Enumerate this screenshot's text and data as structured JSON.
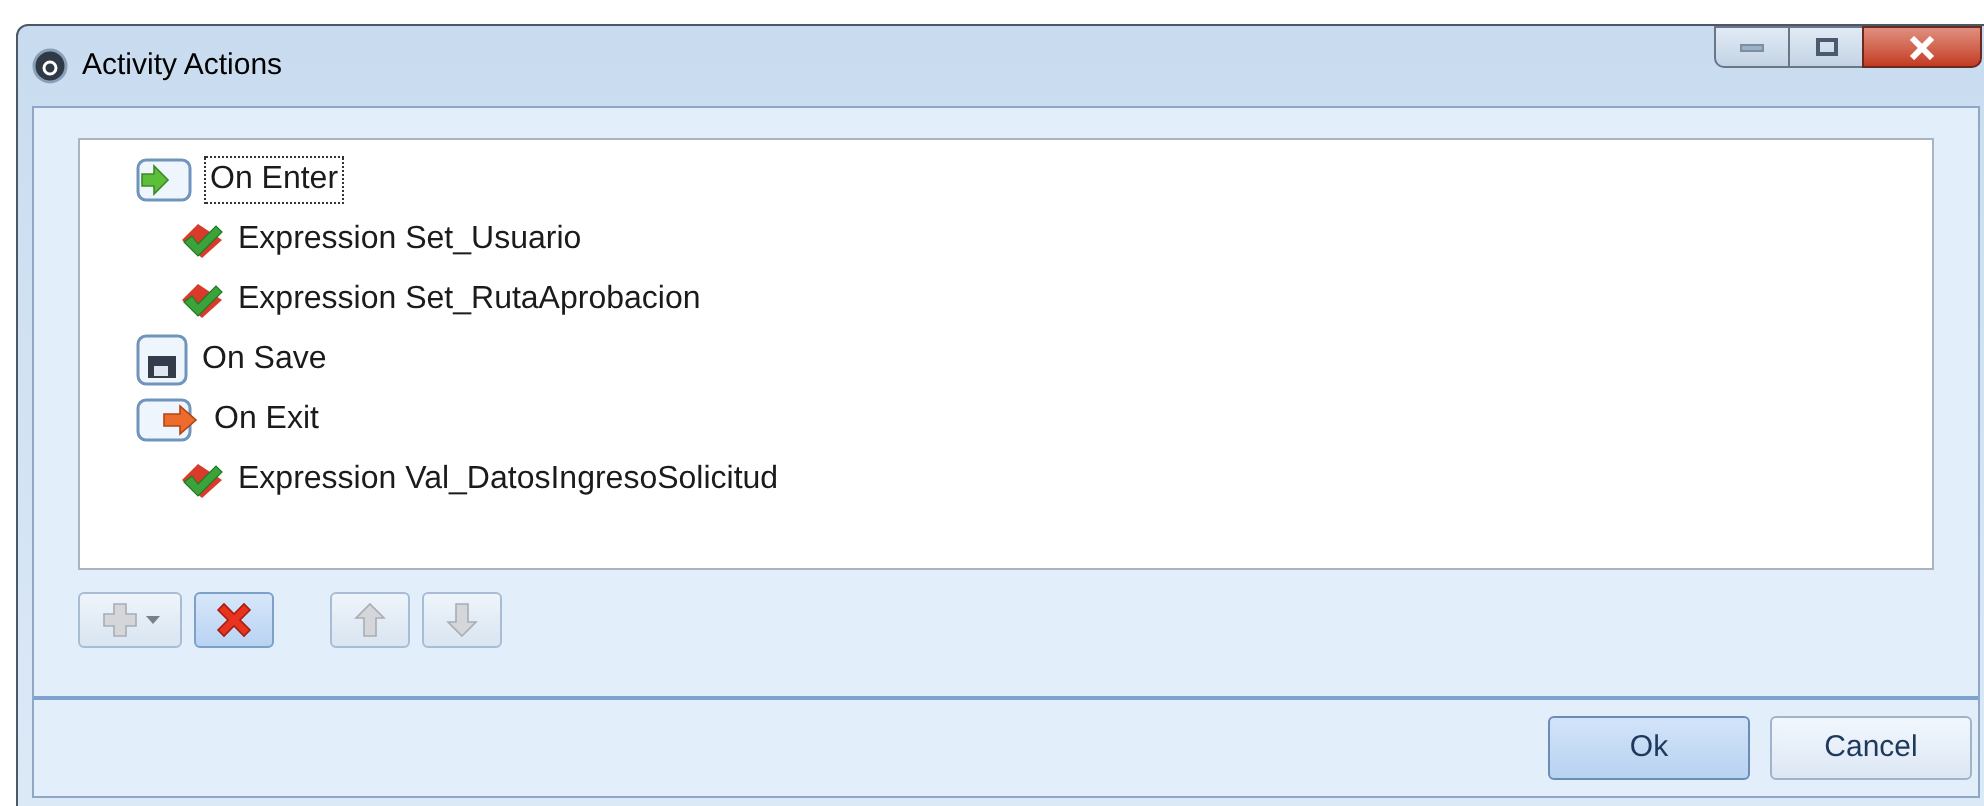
{
  "window": {
    "title": "Activity Actions"
  },
  "tree": [
    {
      "kind": "enter",
      "label": "On Enter",
      "selected": true,
      "children": [
        {
          "kind": "expression",
          "label": "Expression Set_Usuario",
          "selected": false
        },
        {
          "kind": "expression",
          "label": "Expression Set_RutaAprobacion",
          "selected": false
        }
      ]
    },
    {
      "kind": "save",
      "label": "On Save",
      "selected": false
    },
    {
      "kind": "exit",
      "label": "On Exit",
      "selected": false,
      "children": [
        {
          "kind": "expression",
          "label": "Expression Val_DatosIngresoSolicitud",
          "selected": false
        }
      ]
    }
  ],
  "toolbar": [
    {
      "kind": "add",
      "disabled": true
    },
    {
      "kind": "delete",
      "disabled": false
    },
    {
      "kind": "up",
      "disabled": true
    },
    {
      "kind": "down",
      "disabled": true
    }
  ],
  "buttons": [
    {
      "label": "Ok",
      "default": true
    },
    {
      "label": "Cancel",
      "default": false
    }
  ]
}
